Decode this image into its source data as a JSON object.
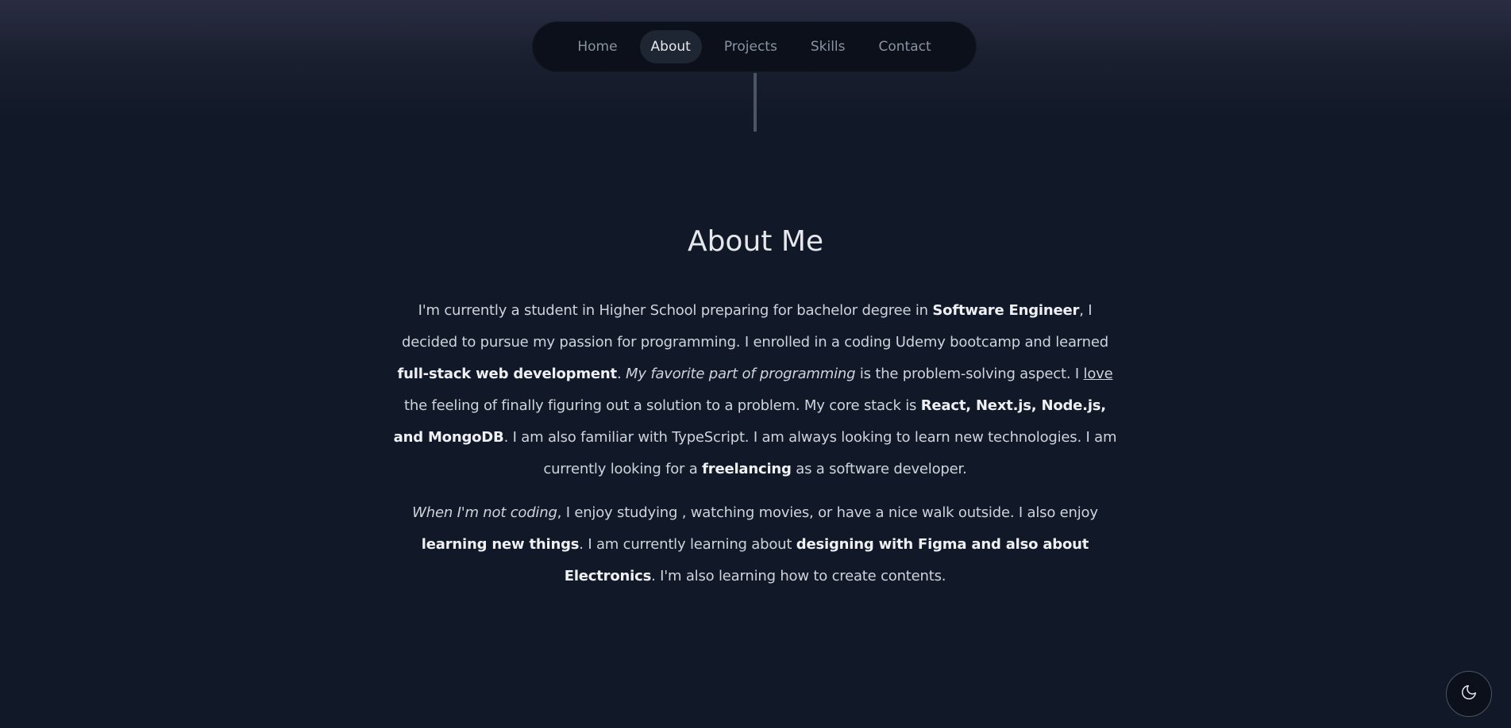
{
  "nav": {
    "items": [
      {
        "label": "Home",
        "active": false
      },
      {
        "label": "About",
        "active": true
      },
      {
        "label": "Projects",
        "active": false
      },
      {
        "label": "Skills",
        "active": false
      },
      {
        "label": "Contact",
        "active": false
      }
    ]
  },
  "about": {
    "title": "About Me",
    "p1": {
      "s1": "I'm currently a student in Higher School preparing for bachelor degree in ",
      "b1": "Software Engineer",
      "s2": ", I decided to pursue my passion for programming. I enrolled in a coding Udemy bootcamp and learned ",
      "b2": "full-stack web development",
      "s3": ". ",
      "i1": "My favorite part of programming",
      "s4": " is the problem-solving aspect. I ",
      "u1": "love",
      "s5": " the feeling of finally figuring out a solution to a problem. My core stack is ",
      "b3": "React, Next.js, Node.js, and MongoDB",
      "s6": ". I am also familiar with TypeScript. I am always looking to learn new technologies. I am currently looking for a ",
      "b4": "freelancing",
      "s7": " as a software developer."
    },
    "p2": {
      "i1": "When I'm not coding",
      "s1": ", I enjoy studying , watching movies, or have a nice walk outside. I also enjoy ",
      "b1": "learning new things",
      "s2": ". I am currently learning about ",
      "b2": "designing with Figma and also about Electronics",
      "s3": ". I'm also learning how to create contents."
    }
  },
  "theme_toggle": {
    "icon": "moon-icon"
  },
  "colors": {
    "background": "#111827",
    "nav_background": "#0b101b",
    "active_pill": "#1f2633",
    "text": "#cfd4dc"
  }
}
